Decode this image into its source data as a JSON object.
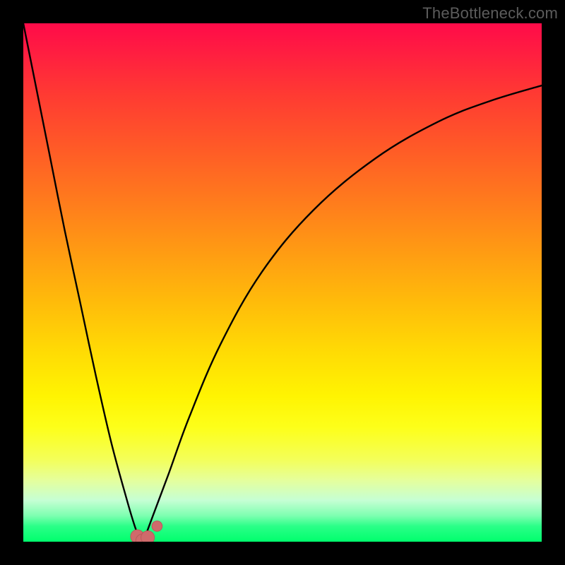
{
  "watermark": "TheBottleneck.com",
  "colors": {
    "frame": "#000000",
    "curve": "#000000",
    "marker_fill": "#cf6a6b",
    "marker_stroke": "#b85a5b"
  },
  "chart_data": {
    "type": "line",
    "title": "",
    "xlabel": "",
    "ylabel": "",
    "xlim": [
      0,
      100
    ],
    "ylim": [
      0,
      100
    ],
    "grid": false,
    "legend": null,
    "series": [
      {
        "name": "left-branch",
        "x": [
          0,
          2,
          5,
          8,
          11,
          14,
          17,
          20,
          21.5,
          22.3,
          22.8,
          23.0
        ],
        "values": [
          100,
          90,
          75,
          60,
          46,
          32,
          19,
          8,
          3,
          1,
          0.3,
          0
        ]
      },
      {
        "name": "right-branch",
        "x": [
          23.0,
          23.5,
          25,
          28,
          32,
          38,
          46,
          56,
          68,
          80,
          90,
          100
        ],
        "values": [
          0,
          1,
          5,
          13,
          24,
          38,
          52,
          64,
          74,
          81,
          85,
          88
        ]
      }
    ],
    "markers": [
      {
        "name": "valley-marker-left",
        "x": 22.0,
        "y": 1.0,
        "r": 1.3
      },
      {
        "name": "valley-marker-bottom",
        "x": 23.0,
        "y": 0.2,
        "r": 1.3
      },
      {
        "name": "valley-marker-right-low",
        "x": 24.0,
        "y": 0.8,
        "r": 1.3
      },
      {
        "name": "valley-marker-right-high",
        "x": 25.8,
        "y": 3.0,
        "r": 1.0
      }
    ],
    "annotations": []
  }
}
